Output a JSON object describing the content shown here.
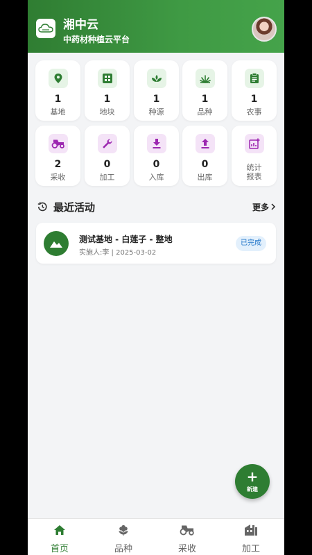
{
  "header": {
    "title": "湘中云",
    "subtitle": "中药材种植云平台"
  },
  "grid": [
    {
      "name": "base",
      "count": "1",
      "label": "基地"
    },
    {
      "name": "plot",
      "count": "1",
      "label": "地块"
    },
    {
      "name": "seed-source",
      "count": "1",
      "label": "种源"
    },
    {
      "name": "variety",
      "count": "1",
      "label": "品种"
    },
    {
      "name": "farm-work",
      "count": "1",
      "label": "农事"
    },
    {
      "name": "harvest",
      "count": "2",
      "label": "采收"
    },
    {
      "name": "processing",
      "count": "0",
      "label": "加工"
    },
    {
      "name": "stock-in",
      "count": "0",
      "label": "入库"
    },
    {
      "name": "stock-out",
      "count": "0",
      "label": "出库"
    },
    {
      "name": "report",
      "label_line1": "统计",
      "label_line2": "报表"
    }
  ],
  "recent": {
    "title": "最近活动",
    "more": "更多",
    "items": [
      {
        "title": "测试基地 - 白莲子 - 整地",
        "sub": "实施人:李 | 2025-03-02",
        "status": "已完成"
      }
    ]
  },
  "fab": {
    "label": "新建"
  },
  "tabbar": [
    {
      "label": "首页",
      "active": true
    },
    {
      "label": "品种",
      "active": false
    },
    {
      "label": "采收",
      "active": false
    },
    {
      "label": "加工",
      "active": false
    }
  ],
  "colors": {
    "primary": "#2e7d32",
    "accent_purple": "#9c27b0",
    "badge_blue": "#1e73c8"
  }
}
